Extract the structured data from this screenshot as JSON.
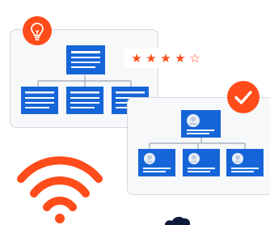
{
  "illustration": {
    "cards": [
      {
        "name": "hierarchy-card-document",
        "style": "document-blocks"
      },
      {
        "name": "hierarchy-card-people",
        "style": "profile-blocks"
      }
    ],
    "rating": {
      "filled": 4,
      "total": 5
    },
    "badges": [
      "lightbulb-icon",
      "checkmark-icon"
    ],
    "icons": [
      "wifi-icon",
      "cloud-icon"
    ],
    "colors": {
      "accent": "#ff4c1a",
      "blue": "#1565d8",
      "card_bg": "#f7f8fa",
      "card_border": "#d3d8df",
      "connector": "#9aa5b5",
      "dark_navy": "#0d1b3a"
    }
  }
}
